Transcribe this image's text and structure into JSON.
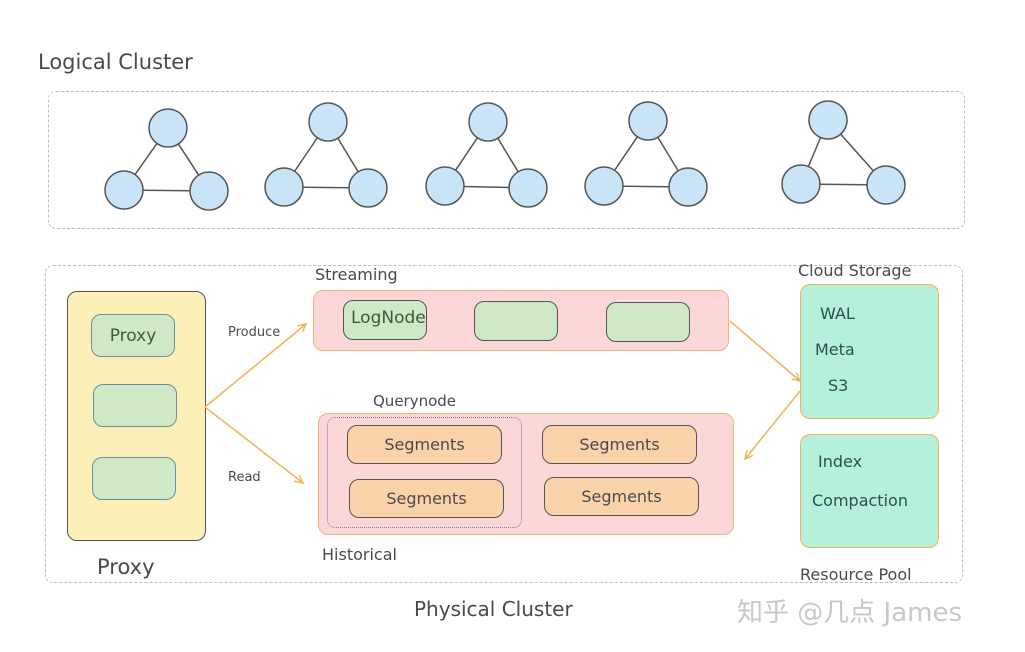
{
  "logical_cluster": {
    "title": "Logical Cluster",
    "groups": [
      {
        "nodes": 3
      },
      {
        "nodes": 3
      },
      {
        "nodes": 3
      },
      {
        "nodes": 3
      },
      {
        "nodes": 3
      }
    ]
  },
  "physical_cluster": {
    "title": "Physical Cluster",
    "proxy": {
      "caption": "Proxy",
      "nodes": [
        "Proxy",
        "",
        ""
      ]
    },
    "edges": {
      "produce": "Produce",
      "read": "Read"
    },
    "streaming": {
      "title": "Streaming",
      "nodes": [
        "LogNode",
        "",
        ""
      ]
    },
    "historical": {
      "title": "Historical",
      "querynode_label": "Querynode",
      "segments": [
        "Segments",
        "Segments",
        "Segments",
        "Segments"
      ]
    },
    "cloud_storage": {
      "title": "Cloud Storage",
      "items": [
        "WAL",
        "Meta",
        "S3"
      ]
    },
    "resource_pool": {
      "title": "Resource Pool",
      "items": [
        "Index",
        "Compaction"
      ]
    }
  },
  "watermark": "知乎 @几点 James",
  "colors": {
    "node_blue": "#c9e3f7",
    "proxy_yellow": "#fcefb8",
    "green_node": "#cfe8c6",
    "pink_container": "#fbd7d8",
    "orange_segment": "#fbd3aa",
    "teal_storage": "#b4f0dc",
    "arrow_orange": "#f0b45a",
    "stroke_dark": "#555555"
  }
}
